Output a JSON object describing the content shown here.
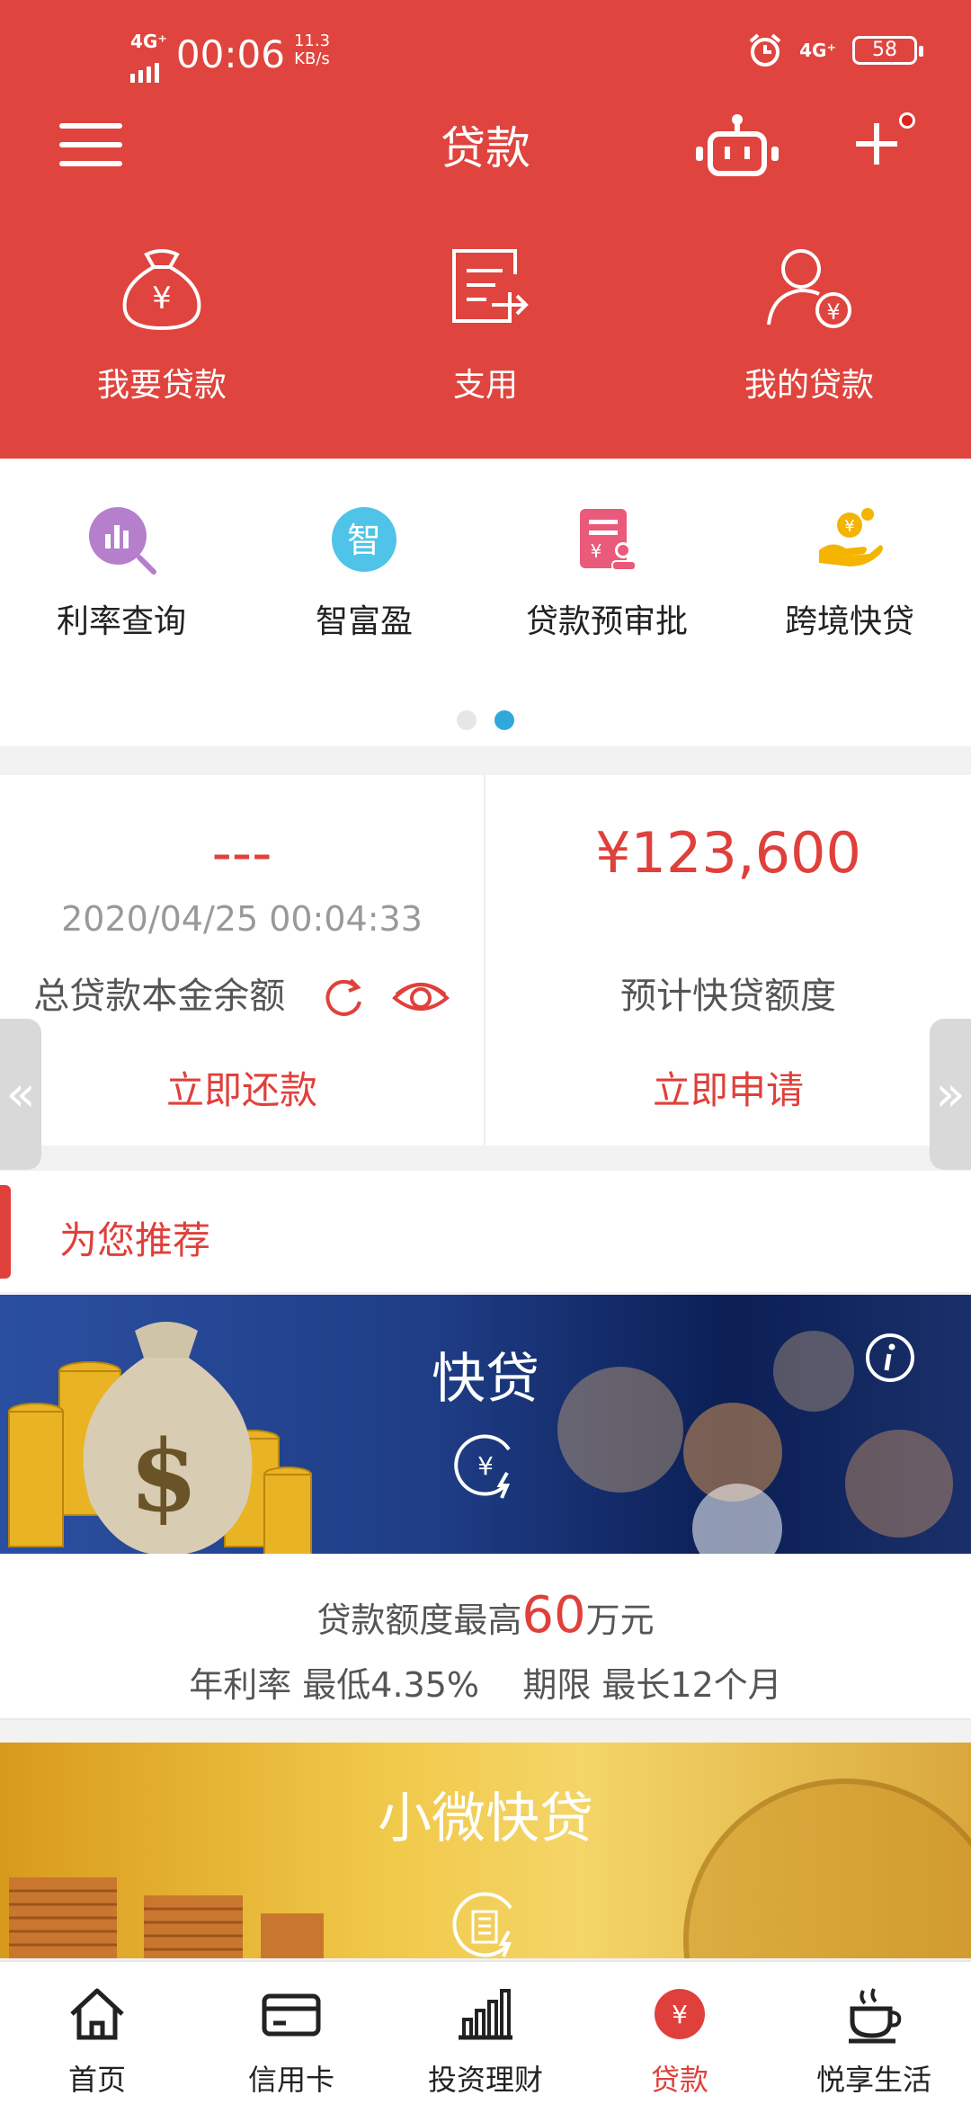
{
  "status_bar": {
    "network": "4G⁺",
    "time": "00:06",
    "speed_value": "11.3",
    "speed_unit": "KB/s",
    "right_network": "4G⁺",
    "battery": "58"
  },
  "header": {
    "title": "贷款",
    "quick_actions": [
      {
        "label": "我要贷款",
        "icon": "money-bag-icon"
      },
      {
        "label": "支用",
        "icon": "transfer-doc-icon"
      },
      {
        "label": "我的贷款",
        "icon": "user-yuan-icon"
      }
    ]
  },
  "services": {
    "items": [
      {
        "label": "利率查询",
        "icon": "rate-search-icon",
        "icon_text": ""
      },
      {
        "label": "智富盈",
        "icon": "zhi-icon",
        "icon_text": "智"
      },
      {
        "label": "贷款预审批",
        "icon": "pre-approve-icon",
        "icon_text": ""
      },
      {
        "label": "跨境快贷",
        "icon": "cross-border-icon",
        "icon_text": ""
      }
    ],
    "pager_active": 2,
    "pager_total": 2
  },
  "loan_summary": {
    "left": {
      "amount": "---",
      "date": "2020/04/25 00:04:33",
      "label": "总贷款本金余额",
      "action": "立即还款"
    },
    "right": {
      "amount": "¥123,600",
      "label": "预计快贷额度",
      "action": "立即申请"
    }
  },
  "recommend": {
    "title": "为您推荐"
  },
  "banner_1": {
    "title": "快贷",
    "info_prefix": "贷款额度最高",
    "info_highlight": "60",
    "info_suffix": "万元",
    "detail": "年利率 最低4.35%    期限 最长12个月"
  },
  "banner_2": {
    "title": "小微快贷"
  },
  "tabbar": {
    "items": [
      {
        "label": "首页",
        "icon": "home-icon"
      },
      {
        "label": "信用卡",
        "icon": "credit-card-icon"
      },
      {
        "label": "投资理财",
        "icon": "bar-chart-icon"
      },
      {
        "label": "贷款",
        "icon": "loan-yuan-icon"
      },
      {
        "label": "悦享生活",
        "icon": "coffee-cup-icon"
      }
    ],
    "active_index": 3
  },
  "colors": {
    "brand_red": "#e0443e",
    "accent_blue": "#31a8db"
  }
}
